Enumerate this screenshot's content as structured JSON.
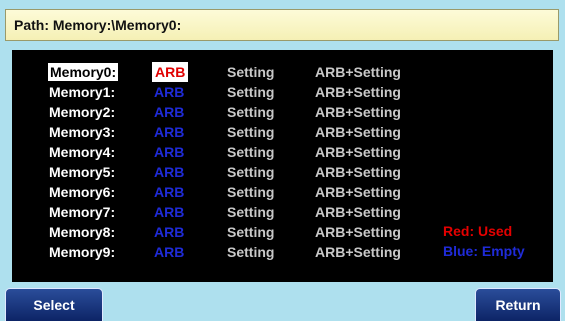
{
  "path": {
    "label": "Path: Memory:\\Memory0:"
  },
  "memory_rows": [
    {
      "name": "Memory0:",
      "arb": "ARB",
      "setting": "Setting",
      "arb_setting": "ARB+Setting",
      "selected": true,
      "arb_used": true
    },
    {
      "name": "Memory1:",
      "arb": "ARB",
      "setting": "Setting",
      "arb_setting": "ARB+Setting",
      "selected": false,
      "arb_used": false
    },
    {
      "name": "Memory2:",
      "arb": "ARB",
      "setting": "Setting",
      "arb_setting": "ARB+Setting",
      "selected": false,
      "arb_used": false
    },
    {
      "name": "Memory3:",
      "arb": "ARB",
      "setting": "Setting",
      "arb_setting": "ARB+Setting",
      "selected": false,
      "arb_used": false
    },
    {
      "name": "Memory4:",
      "arb": "ARB",
      "setting": "Setting",
      "arb_setting": "ARB+Setting",
      "selected": false,
      "arb_used": false
    },
    {
      "name": "Memory5:",
      "arb": "ARB",
      "setting": "Setting",
      "arb_setting": "ARB+Setting",
      "selected": false,
      "arb_used": false
    },
    {
      "name": "Memory6:",
      "arb": "ARB",
      "setting": "Setting",
      "arb_setting": "ARB+Setting",
      "selected": false,
      "arb_used": false
    },
    {
      "name": "Memory7:",
      "arb": "ARB",
      "setting": "Setting",
      "arb_setting": "ARB+Setting",
      "selected": false,
      "arb_used": false
    },
    {
      "name": "Memory8:",
      "arb": "ARB",
      "setting": "Setting",
      "arb_setting": "ARB+Setting",
      "selected": false,
      "arb_used": false
    },
    {
      "name": "Memory9:",
      "arb": "ARB",
      "setting": "Setting",
      "arb_setting": "ARB+Setting",
      "selected": false,
      "arb_used": false
    }
  ],
  "legend": {
    "used": "Red: Used",
    "empty": "Blue: Empty"
  },
  "softkeys": {
    "select": "Select",
    "return": "Return"
  },
  "colors": {
    "used": "#e40000",
    "empty": "#1f2bd8",
    "background": "#aee0ee",
    "path_bar": "#f8f3c0",
    "softkey": "#1a3a85"
  }
}
